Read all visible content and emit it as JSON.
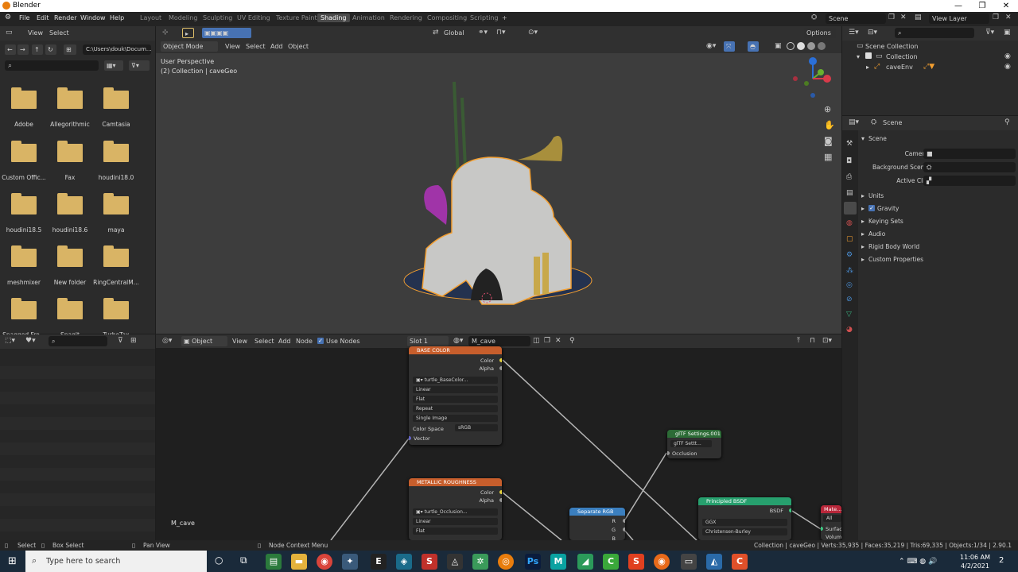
{
  "app": {
    "title": "Blender",
    "window_buttons": {
      "minimize": "—",
      "maximize": "❐",
      "close": "✕"
    }
  },
  "menu": [
    "File",
    "Edit",
    "Render",
    "Window",
    "Help"
  ],
  "workspaces": [
    "Layout",
    "Modeling",
    "Sculpting",
    "UV Editing",
    "Texture Paint",
    "Shading",
    "Animation",
    "Rendering",
    "Compositing",
    "Scripting"
  ],
  "active_workspace": "Shading",
  "add_workspace": "+",
  "scene_selector": {
    "value": "Scene"
  },
  "view_layer_selector": {
    "value": "View Layer"
  },
  "file_browser": {
    "view": "View",
    "select": "Select",
    "path": "C:\\Users\\douk\\Docum...",
    "folders": [
      "Adobe",
      "Allegorithmic",
      "Camtasia",
      "Custom Offic...",
      "Fax",
      "houdini18.0",
      "houdini18.5",
      "houdini18.6",
      "maya",
      "meshmixer",
      "New folder",
      "RingCentralM...",
      "Snagged Fro...",
      "Snagit",
      "TurboTax"
    ]
  },
  "viewport": {
    "mode": "Object Mode",
    "menus": [
      "View",
      "Select",
      "Add",
      "Object"
    ],
    "overlay_title": "User Perspective",
    "overlay_sub": "(2) Collection | caveGeo",
    "transform": "Global",
    "options": "Options",
    "gizmo": {
      "z": "Z",
      "y": "Y",
      "x": "X"
    }
  },
  "outliner": {
    "root": "Scene Collection",
    "collection": "Collection",
    "object": "caveEnv"
  },
  "properties": {
    "header": "Scene",
    "panel": "Scene",
    "camera_label": "Camera",
    "bg_scene_label": "Background Scene",
    "active_clip_label": "Active Clip",
    "sections": [
      "Units",
      "Gravity",
      "Keying Sets",
      "Audio",
      "Rigid Body World",
      "Custom Properties"
    ],
    "gravity_checked": true
  },
  "node_editor": {
    "editor_type": "Object",
    "menus": [
      "View",
      "Select",
      "Add",
      "Node"
    ],
    "use_nodes": "Use Nodes",
    "slot": "Slot 1",
    "material": "M_cave",
    "material_label": "M_cave",
    "nodes": {
      "base_color": {
        "title": "BASE COLOR",
        "out_color": "Color",
        "out_alpha": "Alpha",
        "image": "turtle_BaseColor...",
        "interp": "Linear",
        "proj": "Flat",
        "ext": "Repeat",
        "source": "Single Image",
        "cs_label": "Color Space",
        "cs_value": "sRGB",
        "in_vector": "Vector"
      },
      "metallic": {
        "title": "METALLIC ROUGHNESS",
        "out_color": "Color",
        "out_alpha": "Alpha",
        "image": "turtle_Occlusion...",
        "interp": "Linear",
        "proj": "Flat"
      },
      "gltf": {
        "title": "glTF Settings.001",
        "group": "glTF Settt...",
        "in_occlusion": "Occlusion"
      },
      "separate": {
        "title": "Separate RGB",
        "r": "R",
        "g": "G",
        "b": "B"
      },
      "principled": {
        "title": "Principled BSDF",
        "out": "BSDF",
        "dist": "GGX",
        "sss": "Christensen-Burley"
      },
      "material_output": {
        "title": "Mate...",
        "target": "All",
        "surface": "Surface",
        "volume": "Volume"
      }
    }
  },
  "status": {
    "select": "Select",
    "box_select": "Box Select",
    "pan_view": "Pan View",
    "context_menu": "Node Context Menu",
    "stats": "Collection | caveGeo | Verts:35,935 | Faces:35,219 | Tris:69,335 | Objects:1/34 | 2.90.1"
  },
  "taskbar": {
    "search_placeholder": "Type here to search",
    "time": "11:06 AM",
    "date": "4/2/2021",
    "notifications": "2"
  },
  "colors": {
    "accent": "#4772b3",
    "selection_orange": "#f29e30",
    "node_tex": "#c75e2c",
    "node_shader": "#27a06e",
    "node_converter": "#3b7fbf",
    "node_group": "#2c6b36",
    "node_output": "#b8273a"
  }
}
